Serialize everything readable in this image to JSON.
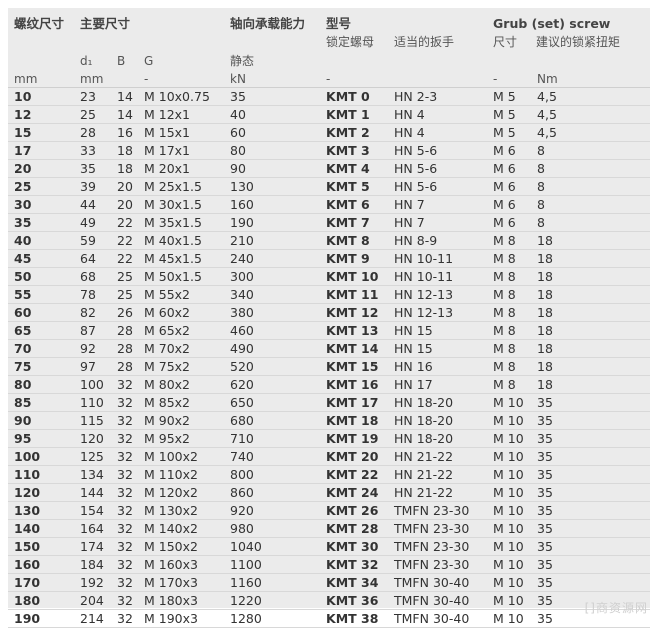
{
  "headers": {
    "thread": "螺纹尺寸",
    "main_dims": "主要尺寸",
    "axial_load": "轴向承载能力",
    "model": "型号",
    "model_sub": "锁定螺母",
    "wrench": "适当的扳手",
    "grub": "Grub (set) screw",
    "grub_size": "尺寸",
    "grub_torque": "建议的锁紧扭矩",
    "d1": "d₁",
    "B": "B",
    "G": "G",
    "static": "静态"
  },
  "units": [
    "mm",
    "mm",
    "",
    "-",
    "kN",
    "-",
    "",
    "-",
    "Nm"
  ],
  "rows": [
    [
      "10",
      "23",
      "14",
      "M 10x0.75",
      "35",
      "KMT 0",
      "HN 2-3",
      "M 5",
      "4,5"
    ],
    [
      "12",
      "25",
      "14",
      "M 12x1",
      "40",
      "KMT 1",
      "HN 4",
      "M 5",
      "4,5"
    ],
    [
      "15",
      "28",
      "16",
      "M 15x1",
      "60",
      "KMT 2",
      "HN 4",
      "M 5",
      "4,5"
    ],
    [
      "17",
      "33",
      "18",
      "M 17x1",
      "80",
      "KMT 3",
      "HN 5-6",
      "M 6",
      "8"
    ],
    [
      "20",
      "35",
      "18",
      "M 20x1",
      "90",
      "KMT 4",
      "HN 5-6",
      "M 6",
      "8"
    ],
    [
      "25",
      "39",
      "20",
      "M 25x1.5",
      "130",
      "KMT 5",
      "HN 5-6",
      "M 6",
      "8"
    ],
    [
      "30",
      "44",
      "20",
      "M 30x1.5",
      "160",
      "KMT 6",
      "HN 7",
      "M 6",
      "8"
    ],
    [
      "35",
      "49",
      "22",
      "M 35x1.5",
      "190",
      "KMT 7",
      "HN 7",
      "M 6",
      "8"
    ],
    [
      "40",
      "59",
      "22",
      "M 40x1.5",
      "210",
      "KMT 8",
      "HN 8-9",
      "M 8",
      "18"
    ],
    [
      "45",
      "64",
      "22",
      "M 45x1.5",
      "240",
      "KMT 9",
      "HN 10-11",
      "M 8",
      "18"
    ],
    [
      "50",
      "68",
      "25",
      "M 50x1.5",
      "300",
      "KMT 10",
      "HN 10-11",
      "M 8",
      "18"
    ],
    [
      "55",
      "78",
      "25",
      "M 55x2",
      "340",
      "KMT 11",
      "HN 12-13",
      "M 8",
      "18"
    ],
    [
      "60",
      "82",
      "26",
      "M 60x2",
      "380",
      "KMT 12",
      "HN 12-13",
      "M 8",
      "18"
    ],
    [
      "65",
      "87",
      "28",
      "M 65x2",
      "460",
      "KMT 13",
      "HN 15",
      "M 8",
      "18"
    ],
    [
      "70",
      "92",
      "28",
      "M 70x2",
      "490",
      "KMT 14",
      "HN 15",
      "M 8",
      "18"
    ],
    [
      "75",
      "97",
      "28",
      "M 75x2",
      "520",
      "KMT 15",
      "HN 16",
      "M 8",
      "18"
    ],
    [
      "80",
      "100",
      "32",
      "M 80x2",
      "620",
      "KMT 16",
      "HN 17",
      "M 8",
      "18"
    ],
    [
      "85",
      "110",
      "32",
      "M 85x2",
      "650",
      "KMT 17",
      "HN 18-20",
      "M 10",
      "35"
    ],
    [
      "90",
      "115",
      "32",
      "M 90x2",
      "680",
      "KMT 18",
      "HN 18-20",
      "M 10",
      "35"
    ],
    [
      "95",
      "120",
      "32",
      "M 95x2",
      "710",
      "KMT 19",
      "HN 18-20",
      "M 10",
      "35"
    ],
    [
      "100",
      "125",
      "32",
      "M 100x2",
      "740",
      "KMT 20",
      "HN 21-22",
      "M 10",
      "35"
    ],
    [
      "110",
      "134",
      "32",
      "M 110x2",
      "800",
      "KMT 22",
      "HN 21-22",
      "M 10",
      "35"
    ],
    [
      "120",
      "144",
      "32",
      "M 120x2",
      "860",
      "KMT 24",
      "HN 21-22",
      "M 10",
      "35"
    ],
    [
      "130",
      "154",
      "32",
      "M 130x2",
      "920",
      "KMT 26",
      "TMFN 23-30",
      "M 10",
      "35"
    ],
    [
      "140",
      "164",
      "32",
      "M 140x2",
      "980",
      "KMT 28",
      "TMFN 23-30",
      "M 10",
      "35"
    ],
    [
      "150",
      "174",
      "32",
      "M 150x2",
      "1040",
      "KMT 30",
      "TMFN 23-30",
      "M 10",
      "35"
    ],
    [
      "160",
      "184",
      "32",
      "M 160x3",
      "1100",
      "KMT 32",
      "TMFN 23-30",
      "M 10",
      "35"
    ],
    [
      "170",
      "192",
      "32",
      "M 170x3",
      "1160",
      "KMT 34",
      "TMFN 30-40",
      "M 10",
      "35"
    ],
    [
      "180",
      "204",
      "32",
      "M 180x3",
      "1220",
      "KMT 36",
      "TMFN 30-40",
      "M 10",
      "35"
    ],
    [
      "190",
      "214",
      "32",
      "M 190x3",
      "1280",
      "KMT 38",
      "TMFN 30-40",
      "M 10",
      "35"
    ]
  ],
  "watermark": "[]商资源网"
}
